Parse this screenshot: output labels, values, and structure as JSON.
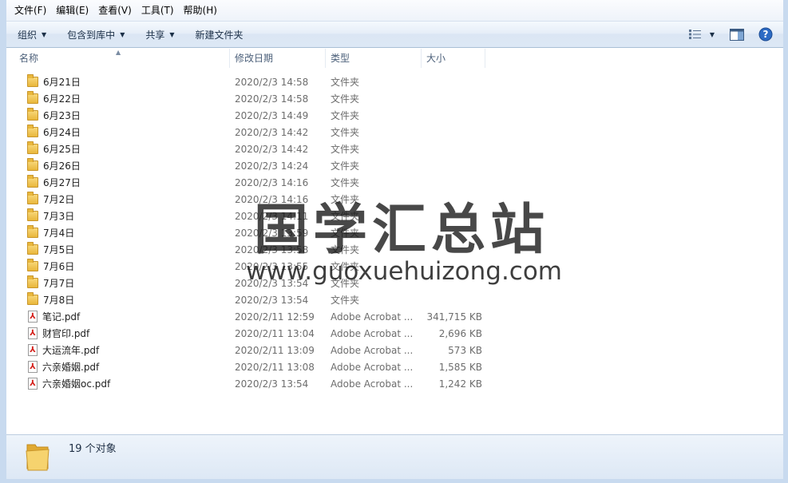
{
  "menu": [
    "文件(F)",
    "编辑(E)",
    "查看(V)",
    "工具(T)",
    "帮助(H)"
  ],
  "toolbar": {
    "organize": "组织",
    "include_library": "包含到库中",
    "share": "共享",
    "new_folder": "新建文件夹"
  },
  "columns": {
    "name": "名称",
    "date": "修改日期",
    "type": "类型",
    "size": "大小"
  },
  "files": [
    {
      "name": "6月21日",
      "date": "2020/2/3 14:58",
      "type": "文件夹",
      "size": "",
      "kind": "folder"
    },
    {
      "name": "6月22日",
      "date": "2020/2/3 14:58",
      "type": "文件夹",
      "size": "",
      "kind": "folder"
    },
    {
      "name": "6月23日",
      "date": "2020/2/3 14:49",
      "type": "文件夹",
      "size": "",
      "kind": "folder"
    },
    {
      "name": "6月24日",
      "date": "2020/2/3 14:42",
      "type": "文件夹",
      "size": "",
      "kind": "folder"
    },
    {
      "name": "6月25日",
      "date": "2020/2/3 14:42",
      "type": "文件夹",
      "size": "",
      "kind": "folder"
    },
    {
      "name": "6月26日",
      "date": "2020/2/3 14:24",
      "type": "文件夹",
      "size": "",
      "kind": "folder"
    },
    {
      "name": "6月27日",
      "date": "2020/2/3 14:16",
      "type": "文件夹",
      "size": "",
      "kind": "folder"
    },
    {
      "name": "7月2日",
      "date": "2020/2/3 14:16",
      "type": "文件夹",
      "size": "",
      "kind": "folder"
    },
    {
      "name": "7月3日",
      "date": "2020/2/3 14:11",
      "type": "文件夹",
      "size": "",
      "kind": "folder"
    },
    {
      "name": "7月4日",
      "date": "2020/2/3 13:59",
      "type": "文件夹",
      "size": "",
      "kind": "folder"
    },
    {
      "name": "7月5日",
      "date": "2020/2/3 13:58",
      "type": "文件夹",
      "size": "",
      "kind": "folder"
    },
    {
      "name": "7月6日",
      "date": "2020/2/3 13:55",
      "type": "文件夹",
      "size": "",
      "kind": "folder"
    },
    {
      "name": "7月7日",
      "date": "2020/2/3 13:54",
      "type": "文件夹",
      "size": "",
      "kind": "folder"
    },
    {
      "name": "7月8日",
      "date": "2020/2/3 13:54",
      "type": "文件夹",
      "size": "",
      "kind": "folder"
    },
    {
      "name": "笔记.pdf",
      "date": "2020/2/11 12:59",
      "type": "Adobe Acrobat ...",
      "size": "341,715 KB",
      "kind": "pdf"
    },
    {
      "name": "财官印.pdf",
      "date": "2020/2/11 13:04",
      "type": "Adobe Acrobat ...",
      "size": "2,696 KB",
      "kind": "pdf"
    },
    {
      "name": "大运流年.pdf",
      "date": "2020/2/11 13:09",
      "type": "Adobe Acrobat ...",
      "size": "573 KB",
      "kind": "pdf"
    },
    {
      "name": "六亲婚姻.pdf",
      "date": "2020/2/11 13:08",
      "type": "Adobe Acrobat ...",
      "size": "1,585 KB",
      "kind": "pdf"
    },
    {
      "name": "六亲婚姻oc.pdf",
      "date": "2020/2/3 13:54",
      "type": "Adobe Acrobat ...",
      "size": "1,242 KB",
      "kind": "pdf"
    }
  ],
  "watermark": {
    "title": "国学汇总站",
    "url": "www.guoxuehuizong.com"
  },
  "status": {
    "count": "19 个对象"
  },
  "colors": {
    "folder": "#e9b73c",
    "pdf_icon": "#d4201b",
    "toolbar_text": "#1b2f47",
    "frame": "#c8daef"
  }
}
